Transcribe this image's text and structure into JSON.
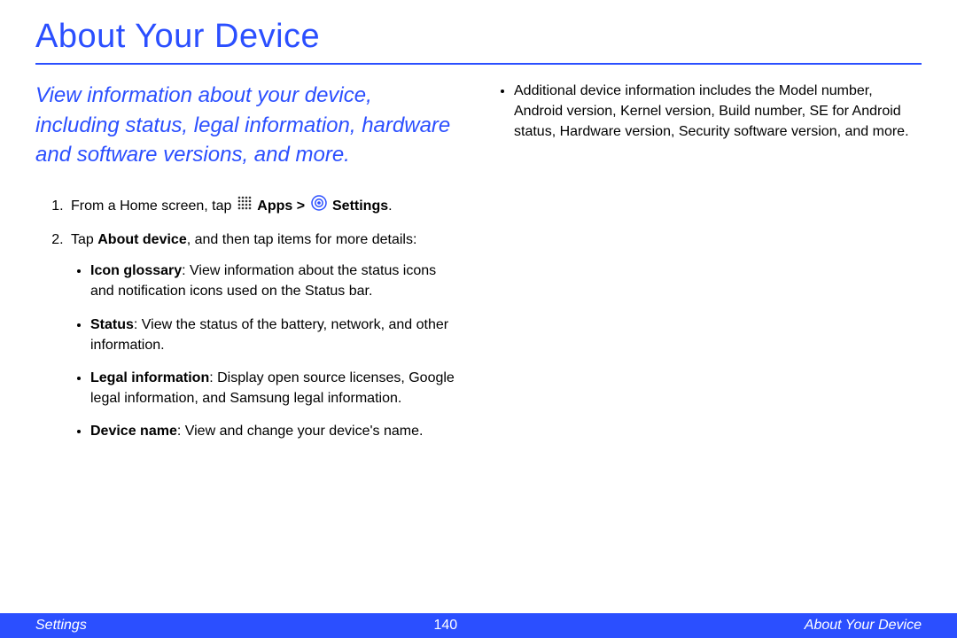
{
  "title": "About Your Device",
  "intro": "View information about your device, including status, legal information, hardware and software versions, and more.",
  "step1_prefix": "From a Home screen, tap ",
  "step1_apps": "Apps",
  "step1_sep": " > ",
  "step1_settings": "Settings",
  "step1_suffix": ".",
  "step2_prefix": "Tap ",
  "step2_bold": "About device",
  "step2_suffix": ", and then tap items for more details:",
  "bullets": [
    {
      "label": "Icon glossary",
      "desc": ": View information about the status icons and notification icons used on the Status bar."
    },
    {
      "label": "Status",
      "desc": ": View the status of the battery, network, and other information."
    },
    {
      "label": "Legal information",
      "desc": ": Display open source licenses, Google legal information, and Samsung legal information."
    },
    {
      "label": "Device name",
      "desc": ": View and change your device's name."
    }
  ],
  "right_bullet": "Additional device information includes the Model number, Android version, Kernel version, Build number, SE for Android status, Hardware version, Security software version, and more.",
  "footer": {
    "left": "Settings",
    "center": "140",
    "right": "About Your Device"
  }
}
